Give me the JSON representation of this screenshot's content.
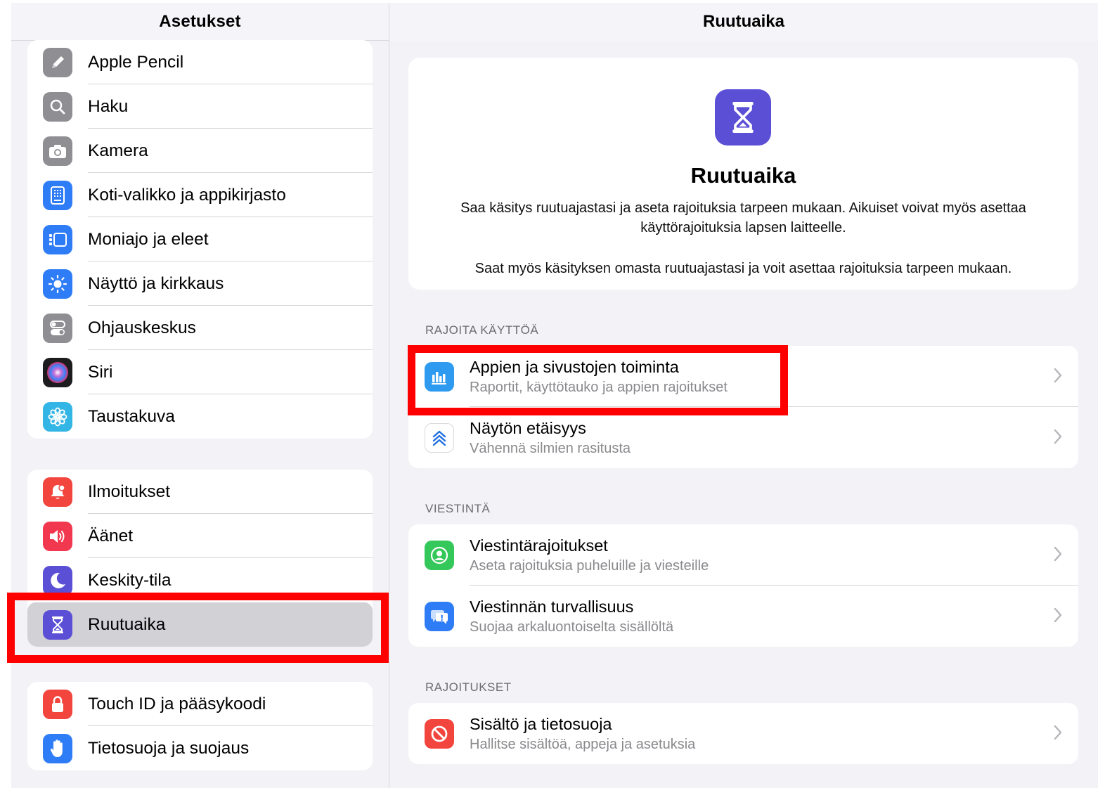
{
  "sidebar": {
    "title": "Asetukset",
    "group1": [
      {
        "label": "Apple Pencil",
        "icon": "pencil-icon",
        "color": "#8e8e93"
      },
      {
        "label": "Haku",
        "icon": "search-icon",
        "color": "#8e8e93"
      },
      {
        "label": "Kamera",
        "icon": "camera-icon",
        "color": "#8e8e93"
      },
      {
        "label": "Koti-valikko ja appikirjasto",
        "icon": "home-screen-icon",
        "color": "#2f7df6"
      },
      {
        "label": "Moniajo ja eleet",
        "icon": "multitasking-icon",
        "color": "#2f7df6"
      },
      {
        "label": "Näyttö ja kirkkaus",
        "icon": "brightness-icon",
        "color": "#2f7df6"
      },
      {
        "label": "Ohjauskeskus",
        "icon": "toggles-icon",
        "color": "#8e8e93"
      },
      {
        "label": "Siri",
        "icon": "siri-icon",
        "color": "#1c1c1e"
      },
      {
        "label": "Taustakuva",
        "icon": "flower-icon",
        "color": "#33b5e5"
      }
    ],
    "group2": [
      {
        "label": "Ilmoitukset",
        "icon": "notification-bell-icon",
        "color": "#f2453d"
      },
      {
        "label": "Äänet",
        "icon": "speaker-icon",
        "color": "#f2384f"
      },
      {
        "label": "Keskity-tila",
        "icon": "moon-icon",
        "color": "#5b4fd6"
      },
      {
        "label": "Ruutuaika",
        "icon": "hourglass-icon",
        "color": "#5b4fd6",
        "selected": true
      }
    ],
    "group3": [
      {
        "label": "Touch ID ja pääsykoodi",
        "icon": "lock-icon",
        "color": "#f2453d"
      },
      {
        "label": "Tietosuoja ja suojaus",
        "icon": "hand-icon",
        "color": "#2f7df6"
      }
    ]
  },
  "detail": {
    "title": "Ruutuaika",
    "hero": {
      "icon": "hourglass-icon",
      "title": "Ruutuaika",
      "description": "Saa käsitys ruutuajastasi ja aseta rajoituksia tarpeen mukaan. Aikuiset voivat myös asettaa käyttörajoituksia lapsen laitteelle.",
      "description2": "Saat myös käsityksen omasta ruutuajastasi ja voit asettaa rajoituksia tarpeen mukaan."
    },
    "sections": [
      {
        "label": "RAJOITA KÄYTTÖÄ",
        "items": [
          {
            "title": "Appien ja sivustojen toiminta",
            "subtitle": "Raportit, käyttötauko ja appien rajoitukset",
            "icon": "bar-chart-icon",
            "color": "#2f9bf0"
          },
          {
            "title": "Näytön etäisyys",
            "subtitle": "Vähennä silmien rasitusta",
            "icon": "chevrons-up-icon",
            "color": "#ffffff"
          }
        ]
      },
      {
        "label": "VIESTINTÄ",
        "items": [
          {
            "title": "Viestintärajoitukset",
            "subtitle": "Aseta rajoituksia puheluille ja viesteille",
            "icon": "contact-icon",
            "color": "#34c759"
          },
          {
            "title": "Viestinnän turvallisuus",
            "subtitle": "Suojaa arkaluontoiselta sisällöltä",
            "icon": "message-warning-icon",
            "color": "#2f7df6"
          }
        ]
      },
      {
        "label": "RAJOITUKSET",
        "items": [
          {
            "title": "Sisältö ja tietosuoja",
            "subtitle": "Hallitse sisältöä, appeja ja asetuksia",
            "icon": "restriction-icon",
            "color": "#f2453d"
          }
        ]
      }
    ]
  },
  "annotation_color": "#ff0000"
}
